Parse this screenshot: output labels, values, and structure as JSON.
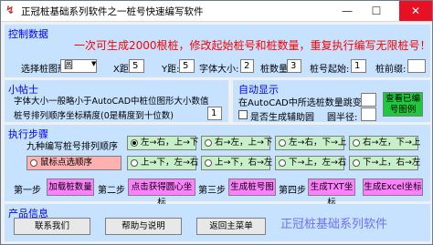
{
  "window": {
    "title": "正冠桩基础系列软件之一桩号快速编写软件",
    "minimize": "—",
    "maximize": "☐",
    "close": "✕"
  },
  "control": {
    "title": "控制数据",
    "headline": "一次可生成2000根桩，修改起始桩号和桩数量，重复执行编写无限桩号！",
    "shape_label": "选择桩图形",
    "shape_value": "圆",
    "x_label": "X距:",
    "x_value": "5",
    "y_label": "Y距:",
    "y_value": "5",
    "font_label": "字体大小:",
    "font_value": "2",
    "count_label": "桩数量:",
    "count_value": "3",
    "start_label": "桩号起始:",
    "start_value": "1",
    "prefix_label": "桩前缀:",
    "prefix_value": ""
  },
  "tips": {
    "title": "小帖士",
    "line1": "字体大小一般略小于AutoCAD中桩位图形大小数值",
    "line2": "桩号排列顺序坐标精度(0是精度到十位数)",
    "precision_value": "1"
  },
  "auto": {
    "title": "自动显示",
    "line1": "在AutoCAD中所选桩数量跳变",
    "count_value": "",
    "checkbox_label": "是否生成辅助圆",
    "radius_label": "圆半径:",
    "radius_value": "",
    "view_button": "查看已编号图例"
  },
  "steps": {
    "title": "执行步骤",
    "order_label": "九种编写桩号排列顺序",
    "orders": [
      "左→右，上→下",
      "右→左，上→下",
      "左→右，下→上",
      "右→左，下→上",
      "上→下，左→右",
      "上→下，右→左",
      "下→上，左→右",
      "下→上，右→左"
    ],
    "mouse_order": "鼠标点选顺序",
    "step1": "第一步",
    "btn1": "加载桩数量",
    "step2": "第二步",
    "btn2": "点击获得圆心坐标",
    "step3": "第三步",
    "btn3": "生成桩号图",
    "step4": "第四步",
    "btn4": "生成TXT坐标",
    "btn5": "生成Excel坐标"
  },
  "product": {
    "title": "产品信息",
    "contact": "联系我们",
    "help": "帮助与说明",
    "back": "返回主菜单",
    "brand": "正冠桩基础系列软件"
  }
}
